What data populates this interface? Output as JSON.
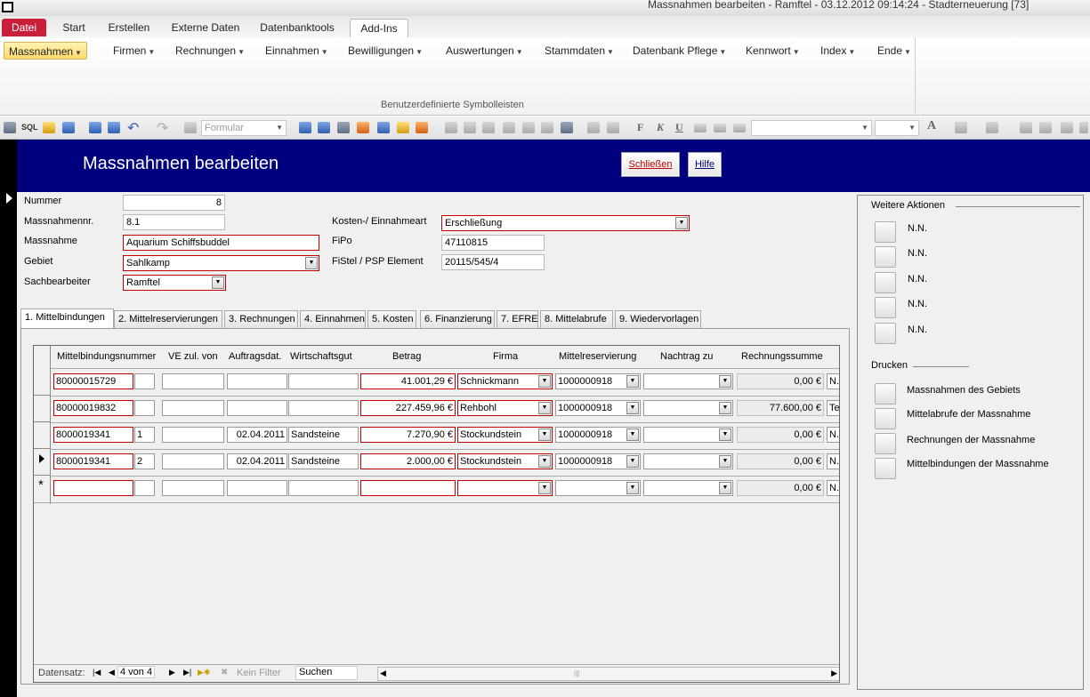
{
  "window": {
    "title": "Massnahmen bearbeiten - Ramftel - 03.12.2012 09:14:24 - Stadterneuerung [73]"
  },
  "ribbon_tabs": [
    "Datei",
    "Start",
    "Erstellen",
    "Externe Daten",
    "Datenbanktools",
    "Add-Ins"
  ],
  "menus": [
    "Massnahmen",
    "Firmen",
    "Rechnungen",
    "Einnahmen",
    "Bewilligungen",
    "Auswertungen",
    "Stammdaten",
    "Datenbank Pflege",
    "Kennwort",
    "Index",
    "Ende"
  ],
  "ribbon_group_label": "Benutzerdefinierte Symbolleisten",
  "toolbar": {
    "sql": "SQL",
    "object_combo": "Formular",
    "bold": "F",
    "italic": "K",
    "underline": "U"
  },
  "header": {
    "title": "Massnahmen bearbeiten",
    "close_label": "Schließen",
    "help_label": "Hilfe"
  },
  "fields": {
    "nummer_label": "Nummer",
    "nummer": "8",
    "massnahmennr_label": "Massnahmennr.",
    "massnahmennr": "8.1",
    "massnahme_label": "Massnahme",
    "massnahme": "Aquarium Schiffsbuddel",
    "gebiet_label": "Gebiet",
    "gebiet": "Sahlkamp",
    "sachbearbeiter_label": "Sachbearbeiter",
    "sachbearbeiter": "Ramftel",
    "kosten_label": "Kosten-/ Einnahmeart",
    "kosten": "Erschließung",
    "fipo_label": "FiPo",
    "fipo": "47110815",
    "fistel_label": "FiStel / PSP Element",
    "fistel": "20115/545/4"
  },
  "form_tabs": [
    "1. Mittelbindungen",
    "2. Mittelreservierungen",
    "3. Rechnungen",
    "4. Einnahmen",
    "5. Kosten",
    "6. Finanzierung",
    "7. EFRE",
    "8. Mittelabrufe",
    "9. Wiedervorlagen"
  ],
  "grid": {
    "columns": [
      "Mittelbindungsnummer",
      "VE zul. von",
      "Auftragsdat.",
      "Wirtschaftsgut",
      "Betrag",
      "Firma",
      "Mittelreservierung",
      "Nachtrag zu",
      "Rechnungssumme"
    ],
    "rows": [
      {
        "nr": "80000015729",
        "ve": "",
        "von": "",
        "datum": "",
        "gut": "",
        "betrag": "41.001,29 €",
        "firma": "Schnickmann",
        "res": "1000000918",
        "nachtrag": "",
        "summe": "0,00 €",
        "extra": "N."
      },
      {
        "nr": "80000019832",
        "ve": "",
        "von": "",
        "datum": "",
        "gut": "",
        "betrag": "227.459,96 €",
        "firma": "Rehbohl",
        "res": "1000000918",
        "nachtrag": "",
        "summe": "77.600,00 €",
        "extra": "Te"
      },
      {
        "nr": "8000019341",
        "ve": "1",
        "von": "",
        "datum": "02.04.2011",
        "gut": "Sandsteine",
        "betrag": "7.270,90 €",
        "firma": "Stockundstein",
        "res": "1000000918",
        "nachtrag": "",
        "summe": "0,00 €",
        "extra": "N."
      },
      {
        "nr": "8000019341",
        "ve": "2",
        "von": "",
        "datum": "02.04.2011",
        "gut": "Sandsteine",
        "betrag": "2.000,00 €",
        "firma": "Stockundstein",
        "res": "1000000918",
        "nachtrag": "",
        "summe": "0,00 €",
        "extra": "N."
      },
      {
        "nr": "",
        "ve": "",
        "von": "",
        "datum": "",
        "gut": "",
        "betrag": "",
        "firma": "",
        "res": "",
        "nachtrag": "",
        "summe": "0,00 €",
        "extra": "N."
      }
    ],
    "new_row_marker": "*"
  },
  "nav": {
    "label": "Datensatz:",
    "position": "4 von 4",
    "filter": "Kein Filter",
    "search": "Suchen"
  },
  "actions": {
    "title": "Weitere Aktionen",
    "items": [
      "N.N.",
      "N.N.",
      "N.N.",
      "N.N.",
      "N.N."
    ],
    "print_title": "Drucken",
    "print_items": [
      "Massnahmen des Gebiets",
      "Mittelabrufe der Massnahme",
      "Rechnungen der Massnahme",
      "Mittelbindungen der Massnahme"
    ]
  }
}
